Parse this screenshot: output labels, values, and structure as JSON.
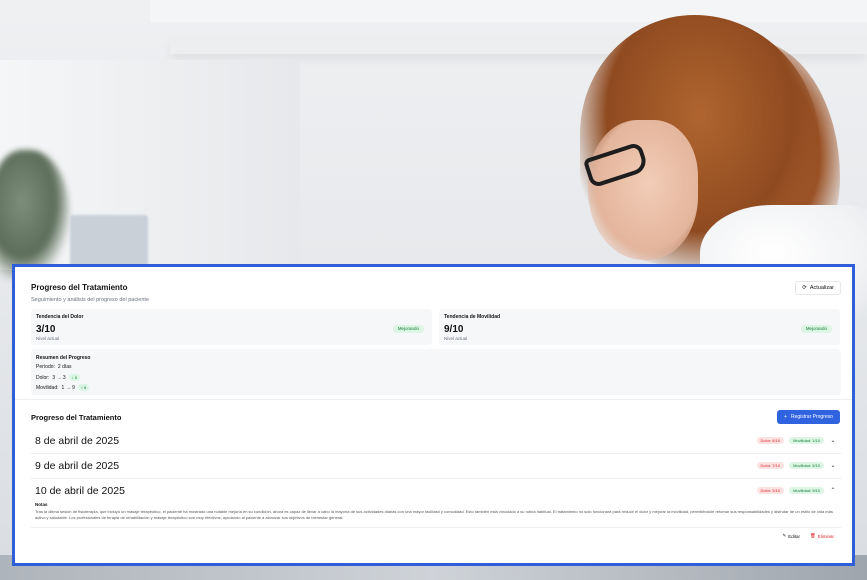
{
  "header": {
    "title": "Progreso del Tratamiento",
    "subtitle": "Seguimiento y análisis del progreso del paciente",
    "refresh_label": "Actualizar"
  },
  "trends": [
    {
      "label": "Tendencia del Dolor",
      "value": "3/10",
      "sub": "Nivel actual",
      "badge": "Mejorando"
    },
    {
      "label": "Tendencia de Movilidad",
      "value": "9/10",
      "sub": "Nivel actual",
      "badge": "Mejorando"
    }
  ],
  "summary": {
    "title": "Resumen del Progreso",
    "period_label": "Período:",
    "period_value": "2 días",
    "pain_label": "Dolor:",
    "pain_value": "3 → 3",
    "pain_badge": "↓ 5",
    "mobility_label": "Movilidad:",
    "mobility_value": "1 → 9",
    "mobility_badge": "↑ 8"
  },
  "history": {
    "title": "Progreso del Tratamiento",
    "register_label": "Registrar Progreso",
    "entries": [
      {
        "date": "8 de abril de 2025",
        "pain": "Dolor: 8/10",
        "mobility": "Movilidad: 1/10",
        "chevron": "⌄"
      },
      {
        "date": "9 de abril de 2025",
        "pain": "Dolor: 7/10",
        "mobility": "Movilidad: 5/10",
        "chevron": "⌄"
      },
      {
        "date": "10 de abril de 2025",
        "pain": "Dolor: 3/10",
        "mobility": "Movilidad: 9/10",
        "chevron": "⌃"
      }
    ],
    "notes_label": "Notas",
    "notes_text": "Tras la última sesión de fisioterapia, que incluyó un masaje terapéutico, el paciente ha mostrado una notable mejoría en su condición, ahora es capaz de llevar a cabo la mayoría de sus actividades diarias con una mayor facilidad y comodidad. Esto también está vinculado a su rutina habitual. El tratamiento no solo funcionará para reducir el dolor y mejorar la movilidad, permitiéndole retomar sus responsabilidades y disfrutar de un estilo de vida más activo y saludable. Los profesionales de terapia de rehabilitación y masaje terapéutico son muy efectivos, ayudando al paciente a alcanzar sus objetivos de bienestar general.",
    "edit_label": "Editar",
    "delete_label": "Eliminar"
  }
}
